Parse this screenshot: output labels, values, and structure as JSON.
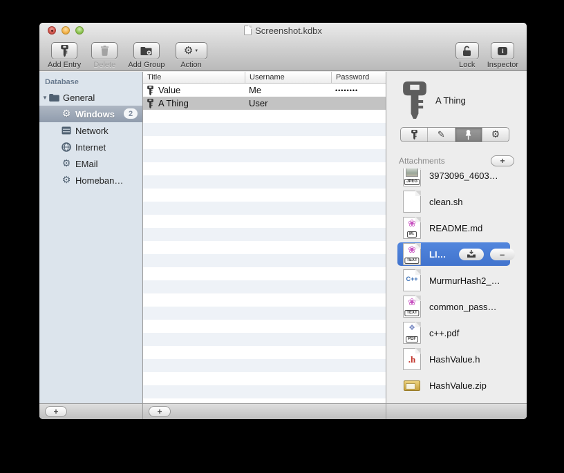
{
  "icons": {
    "gear": "⚙",
    "pencil": "✎",
    "disclosure": "▼",
    "caret_down": "▼",
    "minus": "–",
    "info": "i"
  },
  "titlebar": {
    "title": "Screenshot.kdbx"
  },
  "toolbar": {
    "add_entry": "Add Entry",
    "delete": "Delete",
    "add_group": "Add Group",
    "action": "Action",
    "lock": "Lock",
    "inspector": "Inspector"
  },
  "sidebar": {
    "header": "Database",
    "group": {
      "label": "General"
    },
    "items": [
      {
        "label": "Windows",
        "icon": "gear",
        "badge": "2",
        "selected": true
      },
      {
        "label": "Network",
        "icon": "server",
        "selected": false
      },
      {
        "label": "Internet",
        "icon": "globe",
        "selected": false
      },
      {
        "label": "EMail",
        "icon": "gear",
        "selected": false
      },
      {
        "label": "Homeban…",
        "icon": "gear",
        "selected": false
      }
    ],
    "add_button": "+"
  },
  "entries": {
    "columns": [
      "Title",
      "Username",
      "Password"
    ],
    "rows": [
      {
        "title": "Value",
        "username": "Me",
        "password": "••••••••",
        "selected": false
      },
      {
        "title": "A Thing",
        "username": "User",
        "password": "",
        "selected": true
      }
    ],
    "add_button": "+"
  },
  "inspector": {
    "entry_title": "A Thing",
    "selected_tab": "pushpin",
    "attachments_label": "Attachments",
    "add_button": "+",
    "attachments": [
      {
        "name": "3973096_4603…",
        "kind": "jpeg",
        "badge": "JPEG",
        "selected": false
      },
      {
        "name": "clean.sh",
        "kind": "plain",
        "selected": false
      },
      {
        "name": "README.md",
        "kind": "markdown",
        "badge": "M↓",
        "selected": false
      },
      {
        "name": "LI…",
        "kind": "text",
        "badge": "TEXT",
        "selected": true
      },
      {
        "name": "MurmurHash2_…",
        "kind": "cpp",
        "badge": "C++",
        "selected": false
      },
      {
        "name": "common_pass…",
        "kind": "text",
        "badge": "TEXT",
        "selected": false
      },
      {
        "name": "c++.pdf",
        "kind": "pdf",
        "badge": "PDF",
        "selected": false
      },
      {
        "name": "HashValue.h",
        "kind": "header",
        "badge": ".h",
        "selected": false
      },
      {
        "name": "HashValue.zip",
        "kind": "zip",
        "selected": false
      }
    ]
  },
  "colors": {
    "selection_blue": "#4a7cd6",
    "sidebar_bg": "#dce4ec",
    "stripe_blue": "#eef2f7",
    "inactive_selection_gray": "#c3c3c3"
  }
}
